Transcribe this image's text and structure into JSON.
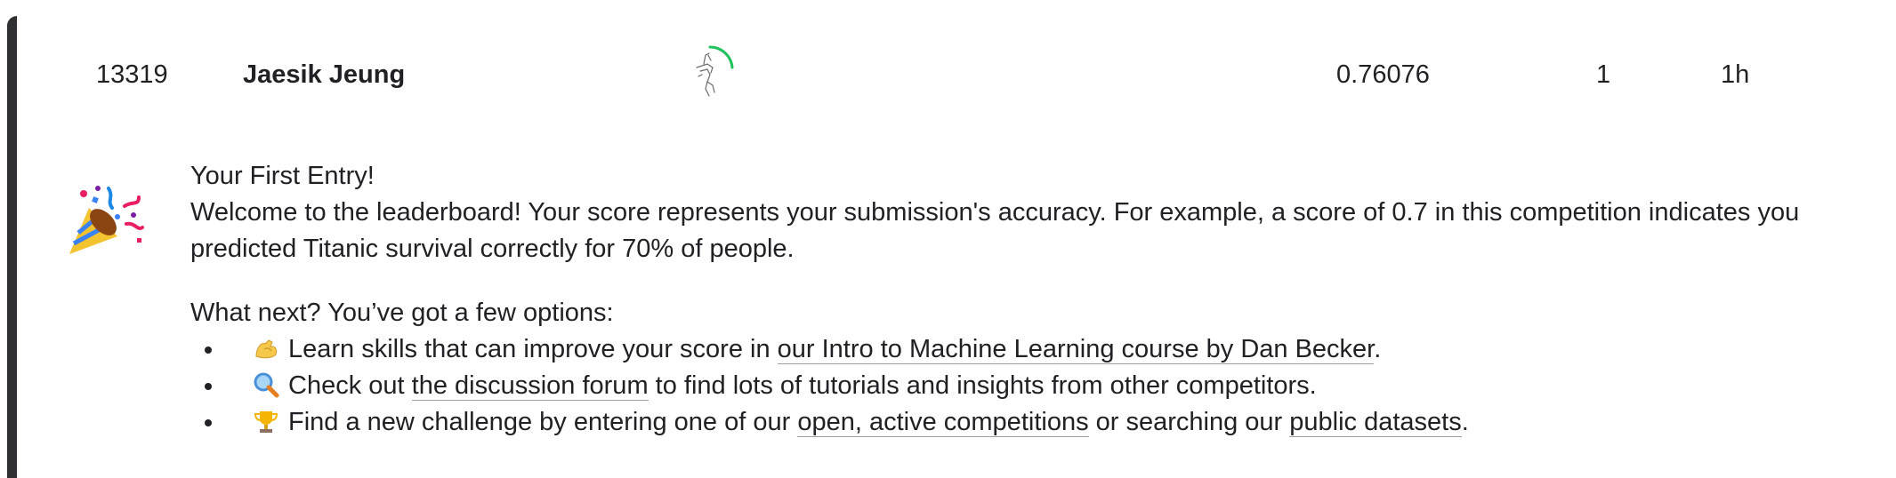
{
  "leaderboard_row": {
    "rank": "13319",
    "team_name": "Jaesik Jeung",
    "score": "0.76076",
    "entries": "1",
    "last": "1h",
    "progress_ring_color": "#20c35b"
  },
  "entry_message": {
    "title": "Your First Entry!",
    "welcome_line_1": "Welcome to the leaderboard! Your score represents your submission's accuracy. For example, a score of 0.7 in this competition indicates you",
    "welcome_line_2": "predicted Titanic survival correctly for 70% of people.",
    "next_heading": "What next? You’ve got a few options:",
    "options": [
      {
        "icon": "flexed-biceps-icon",
        "pre": "Learn skills that can improve your score in ",
        "link": "our Intro to Machine Learning course by Dan Becker",
        "post": "."
      },
      {
        "icon": "magnifying-glass-icon",
        "pre": "Check out ",
        "link": "the discussion forum",
        "post": " to find lots of tutorials and insights from other competitors."
      },
      {
        "icon": "trophy-icon",
        "pre": "Find a new challenge by entering one of our ",
        "link": "open, active competitions",
        "mid": " or searching our ",
        "link2": "public datasets",
        "post": "."
      }
    ]
  },
  "colors": {
    "text": "#202124",
    "left_bar": "#2f3033",
    "link_underline": "#9aa0a6"
  }
}
